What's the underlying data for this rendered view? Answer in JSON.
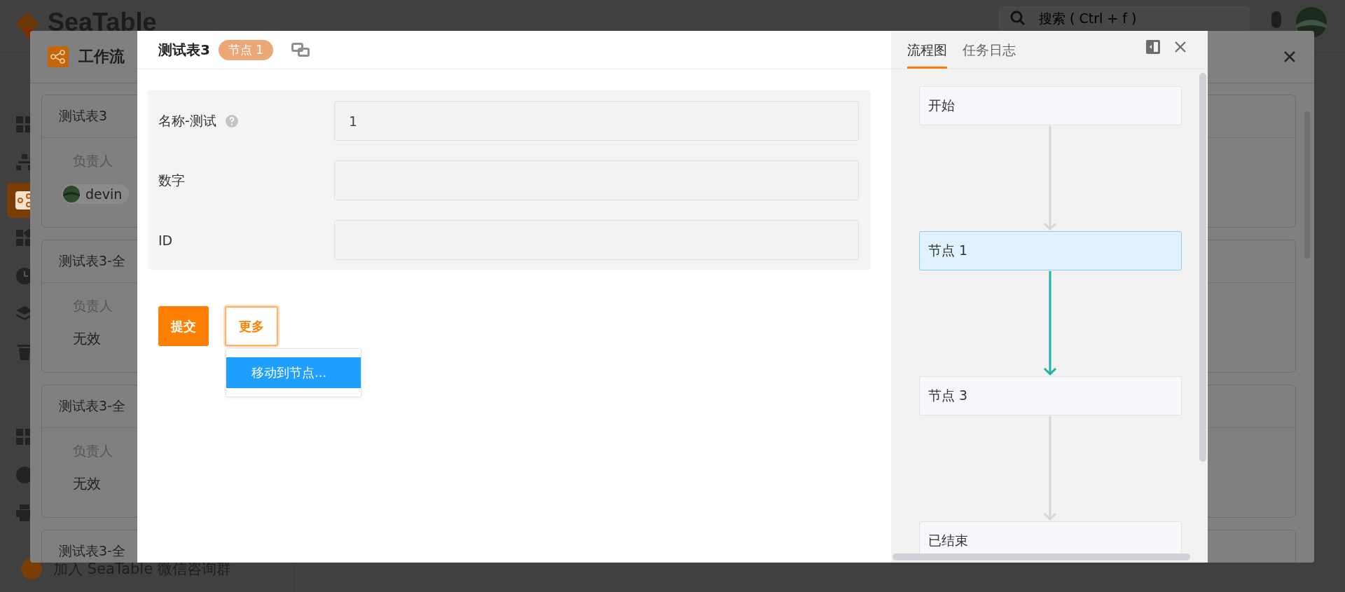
{
  "app": {
    "logo": "SeaTable",
    "search": {
      "placeholder": "搜索 ( Ctrl + f )"
    },
    "sidebar": {
      "items": [
        {
          "selected": false
        },
        {
          "selected": false
        },
        {
          "selected": true
        },
        {
          "selected": false
        },
        {
          "selected": false
        },
        {
          "selected": false
        },
        {
          "selected": false
        },
        {
          "selected": false
        },
        {
          "selected": false
        },
        {
          "selected": false
        }
      ]
    },
    "footer_link": "加入 SeaTable 微信咨询群"
  },
  "workflow_modal": {
    "title": "工作流",
    "cards": [
      {
        "title": "测试表3",
        "owner_label": "负责人",
        "owner": {
          "kind": "user",
          "name": "devin"
        }
      },
      {
        "title": "测试表3-全",
        "owner_label": "负责人",
        "owner": {
          "kind": "text",
          "name": "无效"
        }
      },
      {
        "title": "测试表3-全",
        "owner_label": "负责人",
        "owner": {
          "kind": "text",
          "name": "无效"
        }
      },
      {
        "title": "测试表3-全"
      }
    ]
  },
  "dialog": {
    "title": "测试表3",
    "node_badge": "节点 1",
    "fields": [
      {
        "label": "名称-测试",
        "help": true,
        "value": "1"
      },
      {
        "label": "数字",
        "help": false
      },
      {
        "label": "ID",
        "help": false
      }
    ],
    "buttons": [
      {
        "label": "提交",
        "kind": "primary"
      },
      {
        "label": "更多",
        "kind": "outline",
        "expanded": true
      }
    ],
    "menu": [
      {
        "label": "移动到节点...",
        "selected": true
      }
    ]
  },
  "side_panel": {
    "tabs": [
      {
        "label": "流程图",
        "selected": true
      },
      {
        "label": "任务日志",
        "selected": false
      }
    ],
    "flow": [
      {
        "label": "开始",
        "selected": false
      },
      {
        "label": "节点 1",
        "selected": true
      },
      {
        "label": "节点 3",
        "selected": false
      },
      {
        "label": "已结束",
        "selected": false
      }
    ]
  }
}
